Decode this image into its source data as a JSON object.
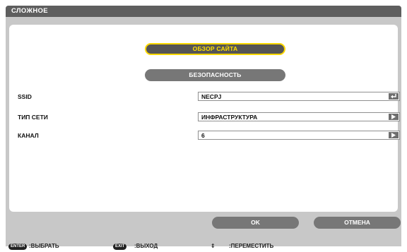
{
  "window": {
    "title": "СЛОЖНОЕ"
  },
  "buttons": {
    "site_survey": "ОБЗОР САЙТА",
    "security": "БЕЗОПАСНОСТЬ",
    "ok": "OK",
    "cancel": "ОТМЕНА"
  },
  "fields": [
    {
      "label": "SSID",
      "value": "NECPJ",
      "icon": "enter-icon"
    },
    {
      "label": "ТИП СЕТИ",
      "value": "ИНФРАСТРУКТУРА",
      "icon": "play-arrow-icon"
    },
    {
      "label": "КАНАЛ",
      "value": "6",
      "icon": "play-arrow-icon"
    }
  ],
  "status_bar": {
    "enter_key": "ENTER",
    "enter_hint": ":ВЫБРАТЬ",
    "exit_key": "EXIT",
    "exit_hint": ":ВЫХОД",
    "move_symbol": "⇕",
    "move_hint": ":ПЕРЕМЕСТИТЬ"
  },
  "colors": {
    "highlight_text": "#ffe000",
    "highlight_border": "#ffd800",
    "button_gray": "#777777",
    "title_bar": "#5e5e5e",
    "frame": "#c8c8c8"
  }
}
